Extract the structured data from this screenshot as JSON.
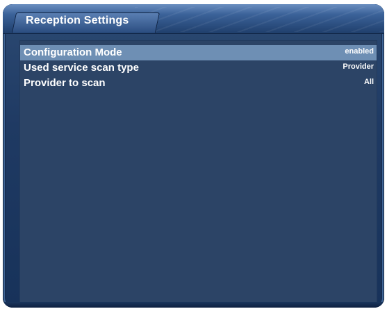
{
  "window": {
    "title": "Reception Settings"
  },
  "settings": {
    "items": [
      {
        "label": "Configuration Mode",
        "value": "enabled",
        "selected": true
      },
      {
        "label": "Used service scan type",
        "value": "Provider",
        "selected": false
      },
      {
        "label": "Provider to scan",
        "value": "All",
        "selected": false
      }
    ]
  },
  "colors": {
    "frame": "#1f3a63",
    "content_bg": "#2c4466",
    "selection": "#6e8fb4",
    "text": "#ffffff"
  }
}
